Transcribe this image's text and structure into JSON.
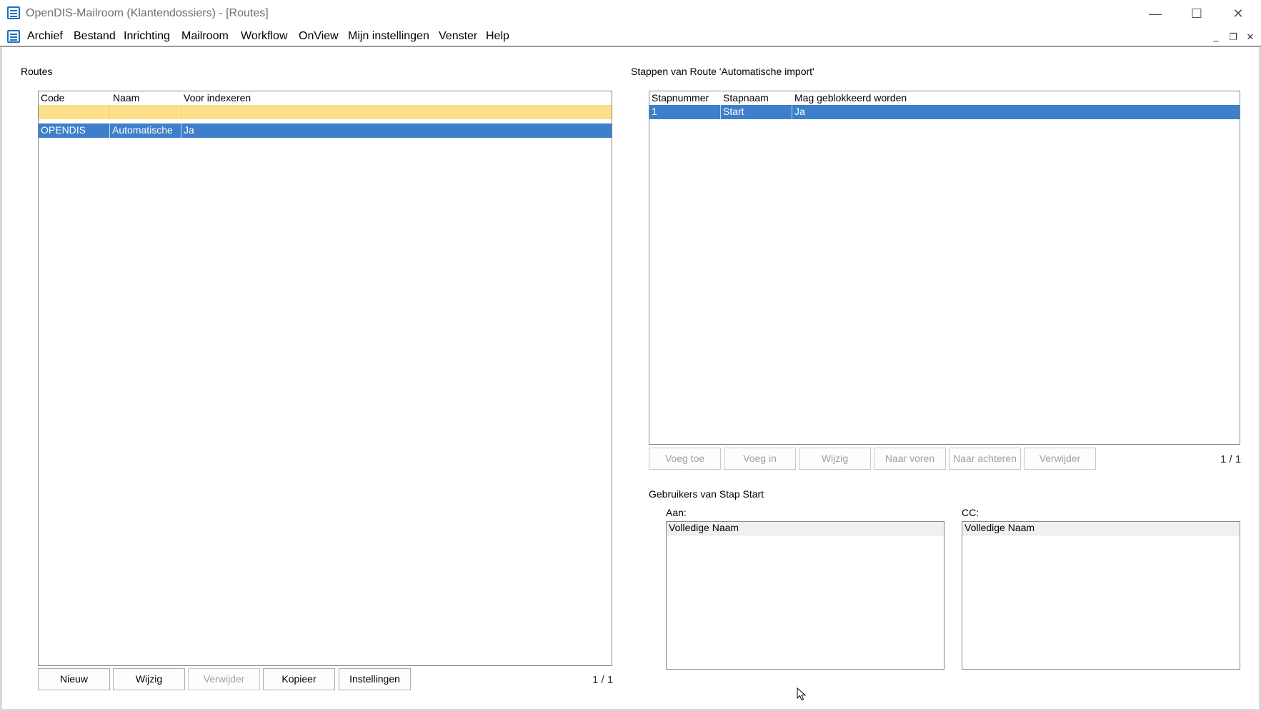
{
  "window": {
    "title": "OpenDIS-Mailroom (Klantendossiers) - [Routes]",
    "minimize": "—",
    "maximize": "☐",
    "close": "✕"
  },
  "menu": {
    "items": [
      "Archief",
      "Bestand",
      "Inrichting",
      "Mailroom",
      "Workflow",
      "OnView",
      "Mijn instellingen",
      "Venster",
      "Help"
    ],
    "mdi_minimize": "_",
    "mdi_restore": "❐",
    "mdi_close": "✕"
  },
  "routes": {
    "label": "Routes",
    "columns": [
      "Code",
      "Naam",
      "Voor indexeren"
    ],
    "rows": [
      {
        "code": "OPENDIS",
        "naam": "Automatische",
        "voor_indexeren": "Ja"
      }
    ],
    "buttons": {
      "new": "Nieuw",
      "edit": "Wijzig",
      "delete": "Verwijder",
      "copy": "Kopieer",
      "settings": "Instellingen"
    },
    "counter": "1 / 1"
  },
  "steps": {
    "label": "Stappen van Route 'Automatische import'",
    "columns": [
      "Stapnummer",
      "Stapnaam",
      "Mag geblokkeerd worden"
    ],
    "rows": [
      {
        "stapnummer": "1",
        "stapnaam": "Start",
        "mag_geblokkeerd": "Ja"
      }
    ],
    "buttons": {
      "add": "Voeg toe",
      "insert": "Voeg in",
      "edit": "Wijzig",
      "forward": "Naar voren",
      "backward": "Naar achteren",
      "delete": "Verwijder"
    },
    "counter": "1 / 1"
  },
  "users": {
    "label": "Gebruikers van Stap Start",
    "to": {
      "label": "Aan:",
      "column": "Volledige Naam"
    },
    "cc": {
      "label": "CC:",
      "column": "Volledige Naam"
    }
  },
  "colors": {
    "selection": "#3d7fca",
    "new_row": "#ffe08a",
    "app_icon": "#1e6fbf"
  }
}
